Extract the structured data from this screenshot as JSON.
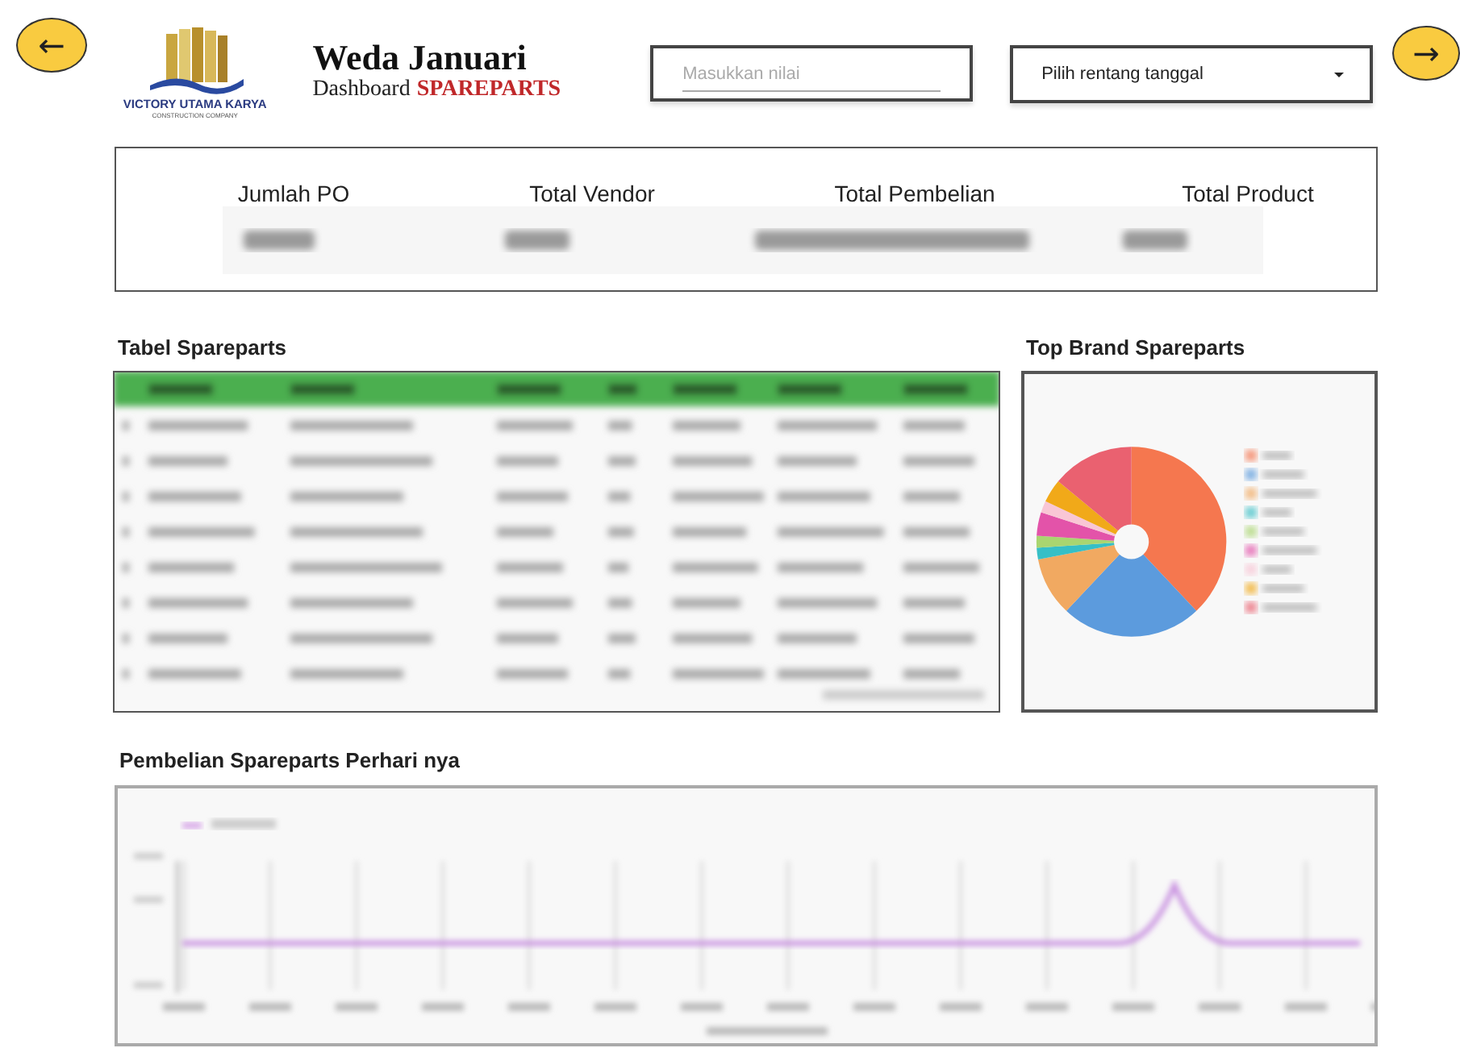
{
  "nav": {
    "back": "←",
    "forward": "→"
  },
  "logo": {
    "name": "VICTORY UTAMA KARYA",
    "tagline": "CONSTRUCTION COMPANY"
  },
  "header": {
    "title": "Weda Januari",
    "subtitle_prefix": "Dashboard",
    "subtitle_emphasis": "SPAREPARTS"
  },
  "filters": {
    "search": {
      "placeholder": "Masukkan nilai"
    },
    "date_range": {
      "label": "Pilih rentang tanggal"
    }
  },
  "kpis": [
    {
      "label": "Jumlah PO"
    },
    {
      "label": "Total Vendor"
    },
    {
      "label": "Total Pembelian"
    },
    {
      "label": "Total Product"
    }
  ],
  "sections": {
    "table_title": "Tabel Spareparts",
    "pie_title": "Top Brand Spareparts",
    "line_title": "Pembelian Spareparts Perhari nya"
  }
}
